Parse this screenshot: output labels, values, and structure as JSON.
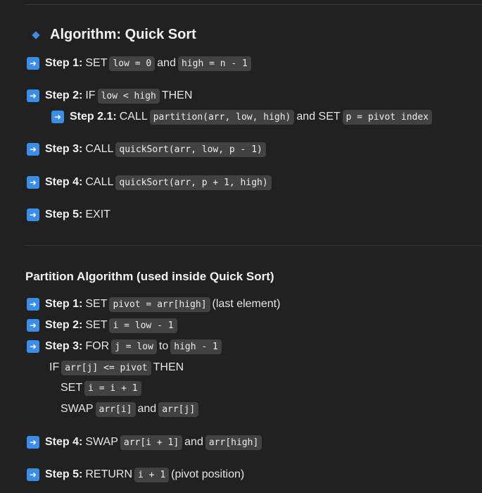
{
  "quick_sort": {
    "title": "Algorithm: Quick Sort",
    "step1": {
      "label": "Step 1:",
      "t1": "SET",
      "c1": "low = 0",
      "t2": "and",
      "c2": "high = n - 1"
    },
    "step2": {
      "label": "Step 2:",
      "t1": "IF",
      "c1": "low < high",
      "t2": "THEN"
    },
    "step21": {
      "label": "Step 2.1:",
      "t1": "CALL",
      "c1": "partition(arr, low, high)",
      "t2": "and SET",
      "c2": "p = pivot index"
    },
    "step3": {
      "label": "Step 3:",
      "t1": "CALL",
      "c1": "quickSort(arr, low, p - 1)"
    },
    "step4": {
      "label": "Step 4:",
      "t1": "CALL",
      "c1": "quickSort(arr, p + 1, high)"
    },
    "step5": {
      "label": "Step 5:",
      "t1": "EXIT"
    }
  },
  "partition": {
    "title": "Partition Algorithm (used inside Quick Sort)",
    "step1": {
      "label": "Step 1:",
      "t1": "SET",
      "c1": "pivot = arr[high]",
      "t2": "(last element)"
    },
    "step2": {
      "label": "Step 2:",
      "t1": "SET",
      "c1": "i = low - 1"
    },
    "step3": {
      "label": "Step 3:",
      "t1": "FOR",
      "c1": "j = low",
      "t2": "to",
      "c2": "high - 1"
    },
    "if_line": {
      "t1": "IF",
      "c1": "arr[j] <= pivot",
      "t2": "THEN"
    },
    "set_line": {
      "t1": "SET",
      "c1": "i = i + 1"
    },
    "swap_line": {
      "t1": "SWAP",
      "c1": "arr[i]",
      "t2": "and",
      "c2": "arr[j]"
    },
    "step4": {
      "label": "Step 4:",
      "t1": "SWAP",
      "c1": "arr[i + 1]",
      "t2": "and",
      "c2": "arr[high]"
    },
    "step5": {
      "label": "Step 5:",
      "t1": "RETURN",
      "c1": "i + 1",
      "t2": "(pivot position)"
    }
  },
  "colors": {
    "background": "#212121",
    "accent": "#3b8ee8",
    "code_bg": "#424242"
  },
  "icons": {
    "bullet": "diamond-icon",
    "step": "arrow-right-icon"
  }
}
